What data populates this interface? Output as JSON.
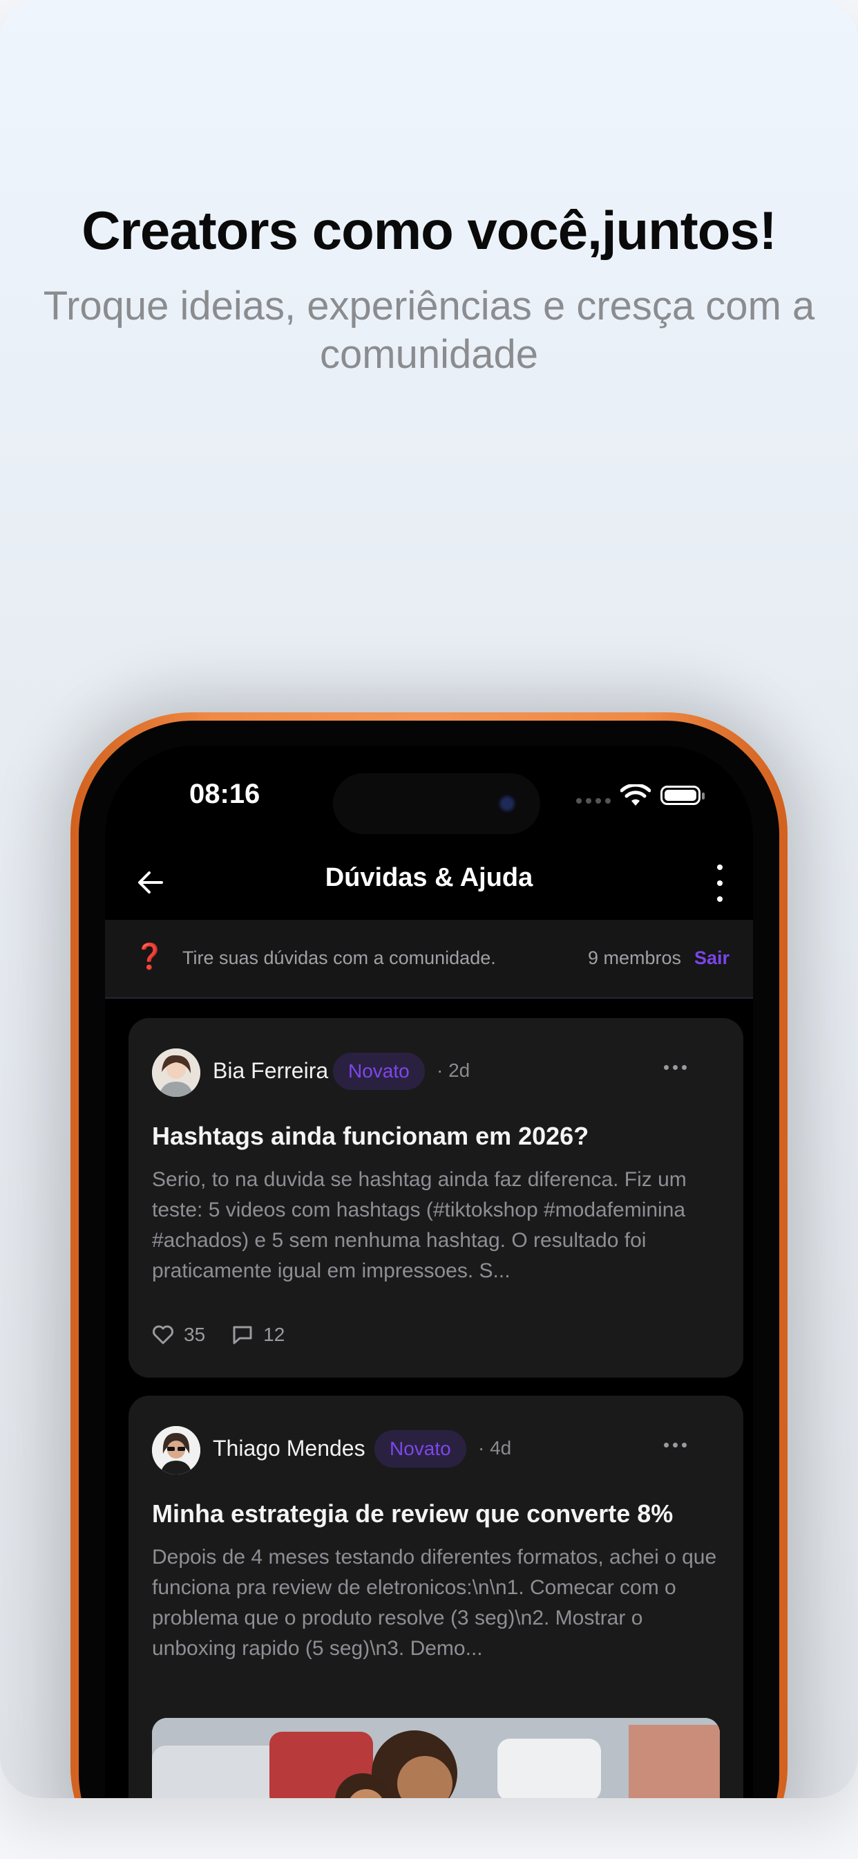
{
  "marketing": {
    "headline": "Creators como você,juntos!",
    "subline": "Troque ideias, experiências e cresça com a comunidade"
  },
  "status_bar": {
    "time": "08:16",
    "icons": [
      "signal-icon",
      "wifi-icon",
      "battery-icon"
    ]
  },
  "nav": {
    "title": "Dúvidas & Ajuda",
    "back_icon": "arrow-left-icon",
    "menu_icon": "more-vertical-icon"
  },
  "banner": {
    "icon": "question-mark-icon",
    "icon_glyph": "❓",
    "text": "Tire suas dúvidas com a comunidade.",
    "members": "9 membros",
    "leave_label": "Sair"
  },
  "posts": [
    {
      "author": "Bia Ferreira",
      "badge": "Novato",
      "age": "· 2d",
      "title": "Hashtags ainda funcionam em 2026?",
      "body": "Serio, to na duvida se hashtag ainda faz diferenca. Fiz um teste: 5 videos com hashtags (#tiktokshop #modafeminina #achados) e 5 sem nenhuma hashtag. O resultado foi praticamente igual em impressoes. S...",
      "likes": "35",
      "comments": "12"
    },
    {
      "author": "Thiago Mendes",
      "badge": "Novato",
      "age": "· 4d",
      "title": "Minha estrategia de review que converte 8%",
      "body": "Depois de 4 meses testando diferentes formatos, achei o que funciona pra review de eletronicos:\\n\\n1. Comecar com o problema que o produto resolve (3 seg)\\n2. Mostrar o unboxing rapido (5 seg)\\n3. Demo..."
    }
  ],
  "colors": {
    "accent": "#7a45e8",
    "phone_frame": "#f08a45",
    "screen_bg": "#000000",
    "card_bg": "#1a1a1a"
  }
}
